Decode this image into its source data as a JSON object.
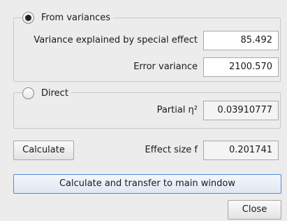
{
  "from_variances": {
    "option_label": "From variances",
    "selected": true,
    "variance_explained_label": "Variance explained by special effect",
    "variance_explained_value": "85.492",
    "error_variance_label": "Error variance",
    "error_variance_value": "2100.570"
  },
  "direct": {
    "option_label": "Direct",
    "selected": false,
    "partial_eta_label": "Partial η²",
    "partial_eta_value": "0.03910777"
  },
  "calculate_button": "Calculate",
  "effect_size_label": "Effect size f",
  "effect_size_value": "0.201741",
  "transfer_button": "Calculate and transfer to main window",
  "close_button": "Close"
}
